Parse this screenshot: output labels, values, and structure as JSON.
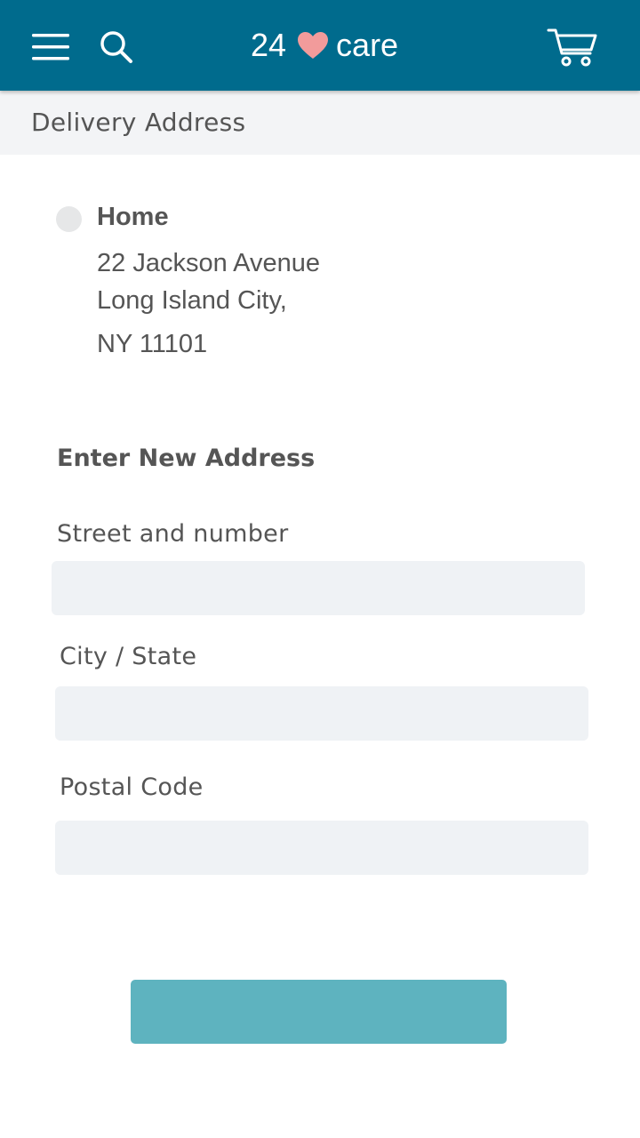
{
  "header": {
    "brand_prefix": "24",
    "brand_suffix": "care",
    "icons": {
      "menu": "hamburger-menu-icon",
      "search": "search-icon",
      "brand_mark": "heart-icon",
      "cart": "cart-icon"
    },
    "colors": {
      "background": "#006b8d",
      "heart": "#f29b9b"
    }
  },
  "subheader": {
    "title": "Delivery Address"
  },
  "saved_address": {
    "name": "Home",
    "lines": [
      "22 Jackson Avenue",
      "Long Island City,",
      "NY 11101"
    ],
    "selected": false
  },
  "new_address": {
    "title": "Enter New Address",
    "fields": [
      {
        "label": "Street and number",
        "value": ""
      },
      {
        "label": "City / State",
        "value": ""
      },
      {
        "label": "Postal Code",
        "value": ""
      }
    ]
  },
  "submit": {
    "label": "",
    "color": "#5eb3bf"
  }
}
